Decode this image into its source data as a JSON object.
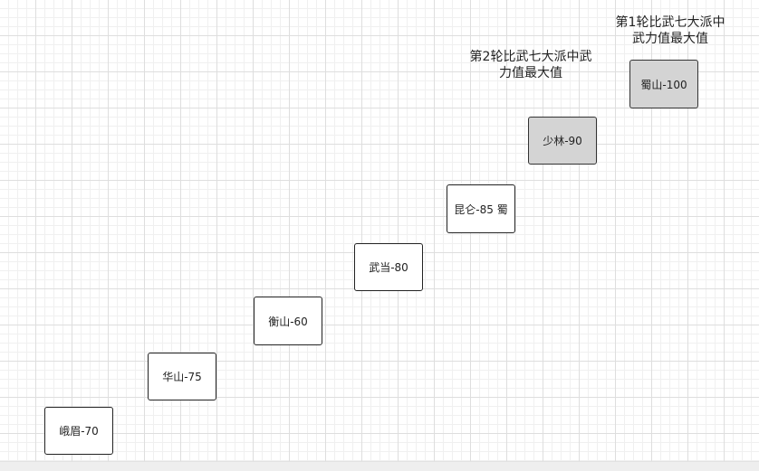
{
  "nodes": {
    "emei": "峨眉-70",
    "huashan": "华山-75",
    "hengshan": "衡山-60",
    "wudang": "武当-80",
    "kunlun": "昆仑-85 蜀",
    "shaolin": "少林-90",
    "shushan": "蜀山-100"
  },
  "notes": {
    "round1": [
      "第1轮比武七大派中",
      "武力值最大值"
    ],
    "round2": [
      "第2轮比武七大派中武",
      "力值最大值"
    ]
  },
  "colors": {
    "grid_major": "#dedede",
    "grid_minor": "#f0f0f0",
    "node_border": "#222222",
    "node_fill": "#ffffff",
    "highlight_fill": "#d4d4d4"
  }
}
